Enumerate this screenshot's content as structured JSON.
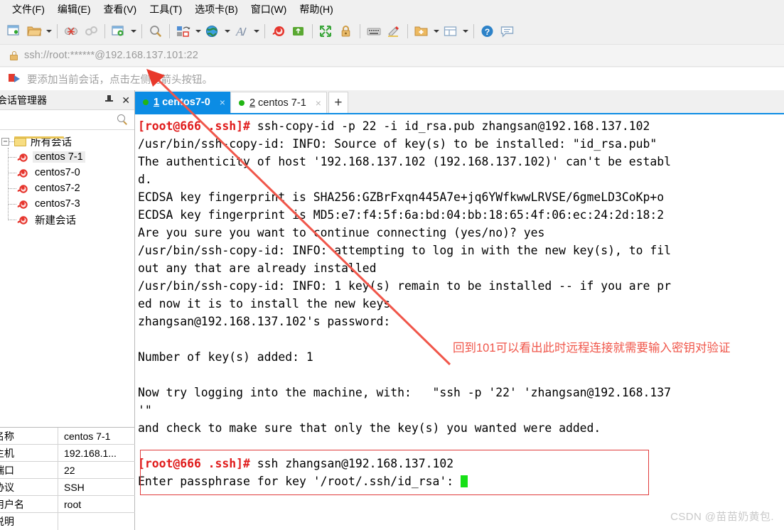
{
  "menubar": {
    "items": [
      {
        "label": "文件(F)",
        "name": "menu-file"
      },
      {
        "label": "编辑(E)",
        "name": "menu-edit"
      },
      {
        "label": "查看(V)",
        "name": "menu-view"
      },
      {
        "label": "工具(T)",
        "name": "menu-tools"
      },
      {
        "label": "选项卡(B)",
        "name": "menu-tabs"
      },
      {
        "label": "窗口(W)",
        "name": "menu-window"
      },
      {
        "label": "帮助(H)",
        "name": "menu-help"
      }
    ]
  },
  "toolbar": {
    "icons": [
      "new-session-icon",
      "open-folder-icon",
      "disconnect-icon",
      "link-icon",
      "session-options-icon",
      "search-icon",
      "transfer-icon",
      "globe-icon",
      "font-icon",
      "snail-icon",
      "upload-icon",
      "fullscreen-icon",
      "lock-icon",
      "keyboard-icon",
      "highlighter-icon",
      "add-folder-icon",
      "layout-icon",
      "help-icon",
      "chat-icon"
    ]
  },
  "addressbar": {
    "icon": "lock-icon",
    "url": "ssh://root:******@192.168.137.101:22"
  },
  "hintbar": {
    "icon": "flag-icon",
    "text": "要添加当前会话，点击左侧的箭头按钮。"
  },
  "sidebar": {
    "title": "会话管理器",
    "pin_icon": "pin-icon",
    "close_icon": "close-icon",
    "search_icon": "search-icon",
    "tree": {
      "root": {
        "label": "所有会话",
        "expander": "−",
        "icon": "folder-icon"
      },
      "items": [
        {
          "label": "centos 7-1",
          "icon": "snail-icon",
          "selected": true
        },
        {
          "label": "centos7-0",
          "icon": "snail-icon",
          "selected": false
        },
        {
          "label": "centos7-2",
          "icon": "snail-icon",
          "selected": false
        },
        {
          "label": "centos7-3",
          "icon": "snail-icon",
          "selected": false
        },
        {
          "label": "新建会话",
          "icon": "snail-icon",
          "selected": false
        }
      ]
    },
    "properties": [
      {
        "key": "名称",
        "value": "centos 7-1"
      },
      {
        "key": "主机",
        "value": "192.168.1..."
      },
      {
        "key": "端口",
        "value": "22"
      },
      {
        "key": "协议",
        "value": "SSH"
      },
      {
        "key": "用户名",
        "value": "root"
      },
      {
        "key": "说明",
        "value": ""
      }
    ]
  },
  "tabs": {
    "items": [
      {
        "num": "1",
        "label": "centos7-0",
        "active": true,
        "status": "connected",
        "close": "×"
      },
      {
        "num": "2",
        "label": "centos 7-1",
        "active": false,
        "status": "connected",
        "close": "×"
      }
    ],
    "add_label": "+"
  },
  "terminal": {
    "lines": [
      {
        "prompt": "[root@666 .ssh]# ",
        "text": "ssh-copy-id -p 22 -i id_rsa.pub zhangsan@192.168.137.102"
      },
      {
        "prompt": "",
        "text": "/usr/bin/ssh-copy-id: INFO: Source of key(s) to be installed: \"id_rsa.pub\""
      },
      {
        "prompt": "",
        "text": "The authenticity of host '192.168.137.102 (192.168.137.102)' can't be establ"
      },
      {
        "prompt": "",
        "text": "d."
      },
      {
        "prompt": "",
        "text": "ECDSA key fingerprint is SHA256:GZBrFxqn445A7e+jq6YWfkwwLRVSE/6gmeLD3CoKp+o"
      },
      {
        "prompt": "",
        "text": "ECDSA key fingerprint is MD5:e7:f4:5f:6a:bd:04:bb:18:65:4f:06:ec:24:2d:18:2"
      },
      {
        "prompt": "",
        "text": "Are you sure you want to continue connecting (yes/no)? yes"
      },
      {
        "prompt": "",
        "text": "/usr/bin/ssh-copy-id: INFO: attempting to log in with the new key(s), to fil"
      },
      {
        "prompt": "",
        "text": "out any that are already installed"
      },
      {
        "prompt": "",
        "text": "/usr/bin/ssh-copy-id: INFO: 1 key(s) remain to be installed -- if you are pr"
      },
      {
        "prompt": "",
        "text": "ed now it is to install the new keys"
      },
      {
        "prompt": "",
        "text": "zhangsan@192.168.137.102's password:"
      },
      {
        "prompt": "",
        "text": ""
      },
      {
        "prompt": "",
        "text": "Number of key(s) added: 1"
      },
      {
        "prompt": "",
        "text": ""
      },
      {
        "prompt": "",
        "text": "Now try logging into the machine, with:   \"ssh -p '22' 'zhangsan@192.168.137"
      },
      {
        "prompt": "",
        "text": "'\""
      },
      {
        "prompt": "",
        "text": "and check to make sure that only the key(s) you wanted were added."
      },
      {
        "prompt": "",
        "text": ""
      }
    ],
    "boxed_lines": [
      {
        "prompt": "[root@666 .ssh]# ",
        "text": "ssh zhangsan@192.168.137.102"
      },
      {
        "prompt": "",
        "text": "Enter passphrase for key '/root/.ssh/id_rsa': "
      }
    ],
    "cursor": "block-cursor"
  },
  "annotation": {
    "text": "回到101可以看出此时远程连接就需要输入密钥对验证",
    "color": "#f0564a"
  },
  "watermark": {
    "text": "CSDN @苗苗奶黄包."
  },
  "colors": {
    "accent": "#0c8ce4",
    "prompt_red": "#e01b1b",
    "annotation_red": "#f0564a",
    "cursor_green": "#17e017",
    "chrome": "#f0f0f0"
  }
}
